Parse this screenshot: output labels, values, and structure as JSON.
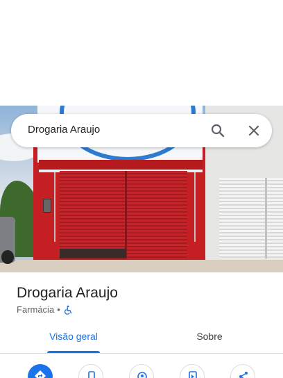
{
  "search": {
    "query": "Drogaria Araujo"
  },
  "place": {
    "name": "Drogaria Araujo",
    "category": "Farmácia",
    "separator": "•"
  },
  "tabs": [
    {
      "label": "Visão geral",
      "selected": true
    },
    {
      "label": "Sobre",
      "selected": false
    }
  ],
  "actions": [
    {
      "icon": "directions-icon"
    },
    {
      "icon": "phone-icon"
    },
    {
      "icon": "location-icon"
    },
    {
      "icon": "save-icon"
    },
    {
      "icon": "share-icon"
    }
  ],
  "colors": {
    "accent": "#1a73e8",
    "text_primary": "#202124",
    "text_secondary": "#5f6368"
  }
}
